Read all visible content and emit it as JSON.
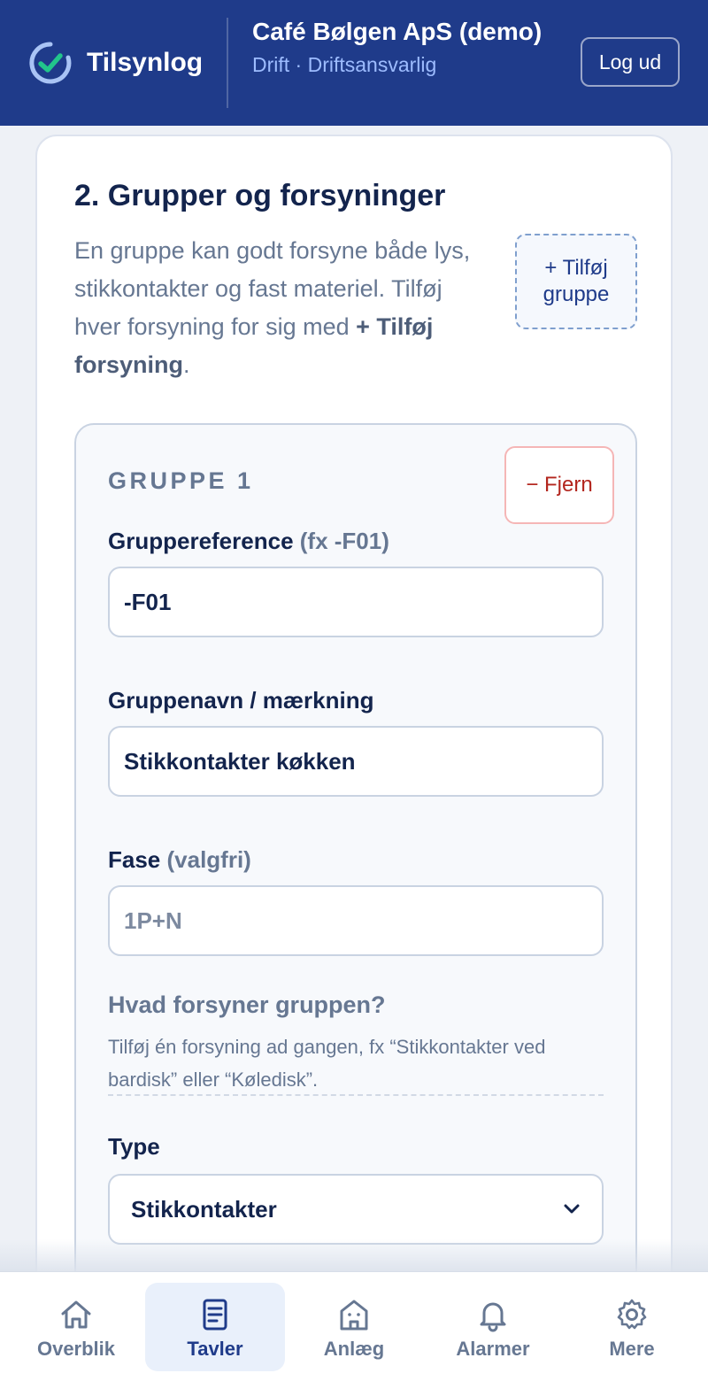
{
  "header": {
    "app_name": "Tilsynlog",
    "org_name": "Café Bølgen ApS (demo)",
    "org_role": "Drift · Driftsansvarlig",
    "logout_label": "Log ud",
    "colors": {
      "background": "#1f3b8a",
      "accent": "#9dbcff",
      "check": "#22c58b"
    }
  },
  "section": {
    "title": "2. Grupper og forsyninger",
    "description_text": "En gruppe kan godt forsyne både lys, stikkontakter og fast materiel. Tilføj hver forsyning for sig med ",
    "description_strong": "+ Tilføj forsyning",
    "description_end": ".",
    "add_group_line1": "+ Tilføj",
    "add_group_line2": "gruppe"
  },
  "group": {
    "title": "GRUPPE 1",
    "remove_label": "− Fjern",
    "reference": {
      "label": "Gruppereference",
      "hint": "(fx -F01)",
      "value": "-F01"
    },
    "name": {
      "label": "Gruppenavn / mærkning",
      "value": "Stikkontakter køkken"
    },
    "phase": {
      "label": "Fase",
      "hint": "(valgfri)",
      "value": "",
      "placeholder": "1P+N"
    },
    "supply": {
      "title": "Hvad forsyner gruppen?",
      "description": "Tilføj én forsyning ad gangen, fx “Stikkontakter ved bardisk” eller “Køledisk”."
    },
    "type": {
      "label": "Type",
      "value": "Stikkontakter",
      "icon": "chevron-down-icon"
    }
  },
  "nav": {
    "active": "tavler",
    "items": [
      {
        "label": "Overblik",
        "icon": "home-icon"
      },
      {
        "label": "Tavler",
        "icon": "document-icon"
      },
      {
        "label": "Anlæg",
        "icon": "building-icon"
      },
      {
        "label": "Alarmer",
        "icon": "bell-icon"
      },
      {
        "label": "Mere",
        "icon": "gear-icon"
      }
    ]
  }
}
